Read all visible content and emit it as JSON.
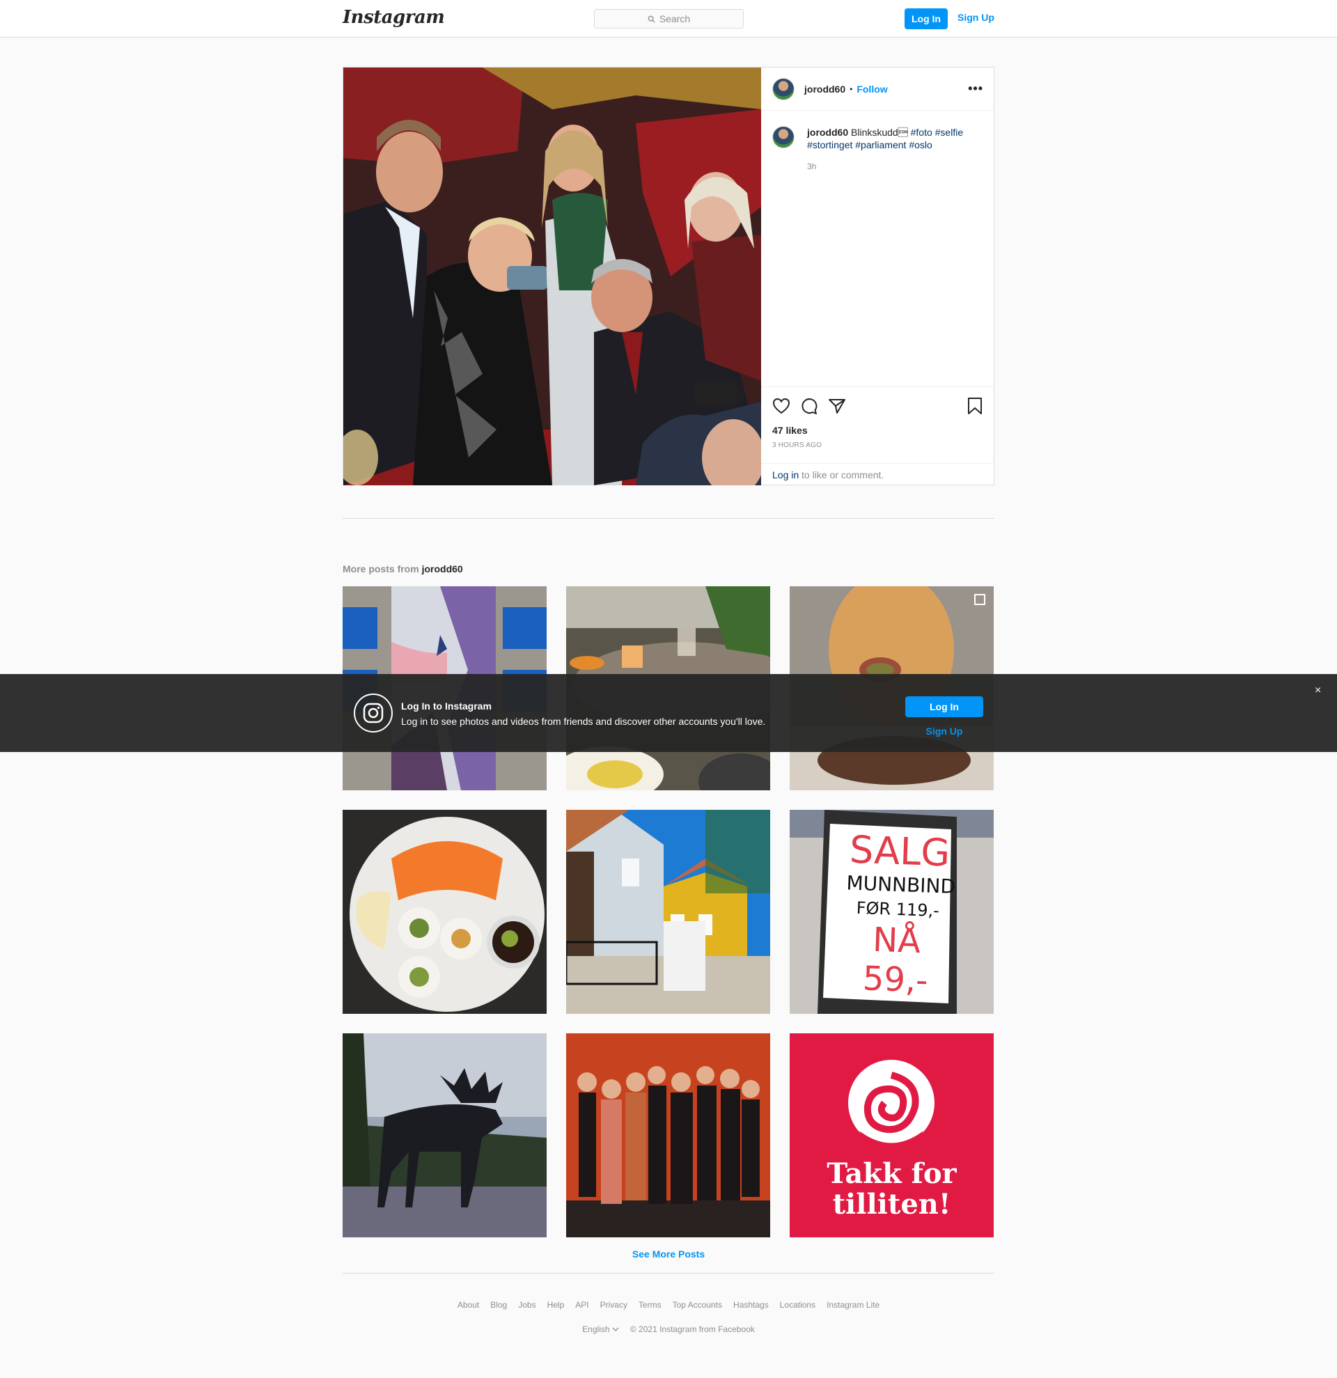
{
  "header": {
    "logo": "Instagram",
    "search_placeholder": "Search",
    "login_label": "Log In",
    "signup_label": "Sign Up"
  },
  "post": {
    "username": "jorodd60",
    "separator": "•",
    "follow_label": "Follow",
    "more_label": "•••",
    "caption_text": "Blinkskudd\u0001",
    "hashtags": [
      "#foto",
      "#selfie",
      "#stortinget",
      "#parliament",
      "#oslo"
    ],
    "caption_time": "3h",
    "likes": "47 likes",
    "time_ago": "3 HOURS AGO",
    "login_link": "Log in",
    "login_rest": " to like or comment."
  },
  "more_posts": {
    "label": "More posts from",
    "username": "jorodd60",
    "see_more": "See More Posts"
  },
  "grid_texts": {
    "sign_salg": "SALG",
    "sign_munnbind": "MUNNBIND",
    "sign_for": "FØR 119,-",
    "sign_na": "NÅ 59,-",
    "takk_line1": "Takk for",
    "takk_line2": "tilliten!"
  },
  "banner": {
    "title": "Log In to Instagram",
    "subtitle": "Log in to see photos and videos from friends and discover other accounts you'll love.",
    "login_label": "Log In",
    "signup_label": "Sign Up",
    "close": "×"
  },
  "footer": {
    "links": [
      "About",
      "Blog",
      "Jobs",
      "Help",
      "API",
      "Privacy",
      "Terms",
      "Top Accounts",
      "Hashtags",
      "Locations",
      "Instagram Lite"
    ],
    "language": "English",
    "copyright": "© 2021 Instagram from Facebook"
  },
  "colors": {
    "accent": "#0095f6",
    "hashtag": "#00376b",
    "muted": "#8e8e8e",
    "banner_bg": "#262626",
    "takk_bg": "#e01a43"
  }
}
